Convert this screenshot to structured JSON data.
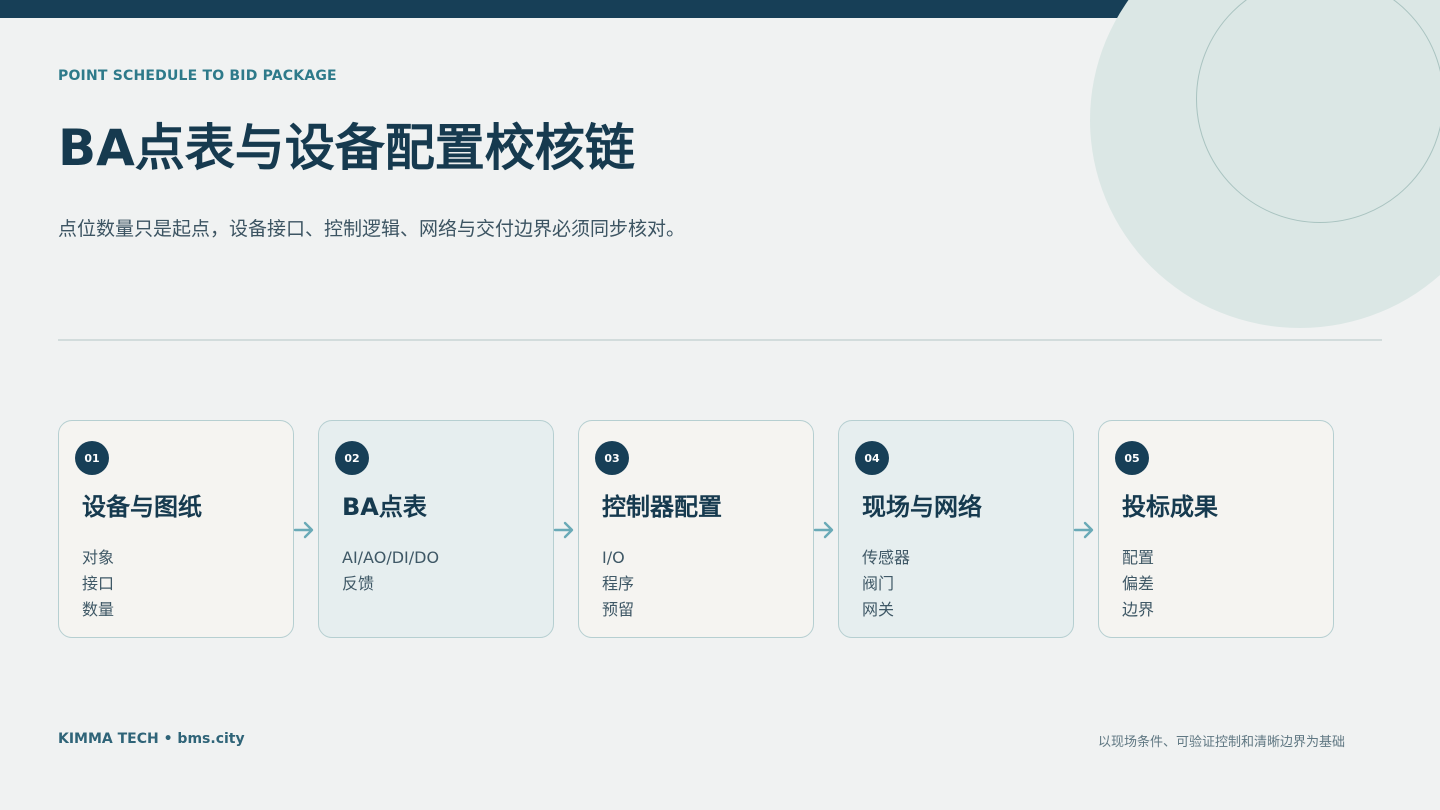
{
  "header": {
    "eyebrow": "POINT SCHEDULE TO BID PACKAGE",
    "title": "BA点表与设备配置校核链",
    "subtitle": "点位数量只是起点，设备接口、控制逻辑、网络与交付边界必须同步核对。"
  },
  "steps": [
    {
      "number": "01",
      "title": "设备与图纸",
      "items": [
        "对象",
        "接口",
        "数量"
      ]
    },
    {
      "number": "02",
      "title": "BA点表",
      "items": [
        "AI/AO/DI/DO",
        "反馈"
      ]
    },
    {
      "number": "03",
      "title": "控制器配置",
      "items": [
        "I/O",
        "程序",
        "预留"
      ]
    },
    {
      "number": "04",
      "title": "现场与网络",
      "items": [
        "传感器",
        "阀门",
        "网关"
      ]
    },
    {
      "number": "05",
      "title": "投标成果",
      "items": [
        "配置",
        "偏差",
        "边界"
      ]
    }
  ],
  "footer": {
    "brand": "KIMMA TECH • bms.city",
    "tagline": "以现场条件、可验证控制和清晰边界为基础"
  },
  "colors": {
    "primary": "#173f57",
    "accent": "#2e7a8a",
    "arrow": "#6aaab7",
    "background": "#f0f2f2"
  }
}
